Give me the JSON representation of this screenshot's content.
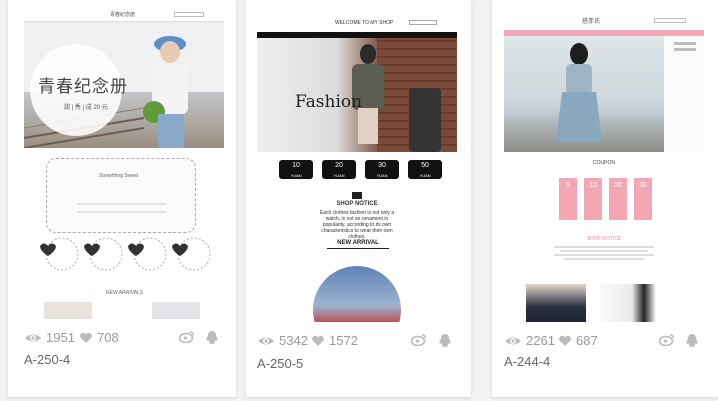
{
  "cards": [
    {
      "code": "A-250-4",
      "views": "1951",
      "likes": "708",
      "thumb": {
        "header_text": "青春纪念册",
        "hero_title": "青春纪念册",
        "hero_tags": "甜 | 秀 | 成 20 元",
        "frame_caption": "Something Sweet",
        "bottom_caption": "NEW ARRIVALS"
      }
    },
    {
      "code": "A-250-5",
      "views": "5342",
      "likes": "1572",
      "thumb": {
        "header_text": "WELCOME TO MY SHOP",
        "hero_word": "Fashion",
        "coupons": [
          "10",
          "20",
          "30",
          "50"
        ],
        "coupon_unit": "YUAN",
        "notice_title": "SHOP NOTICE",
        "notice_text": "Each clothes fashion is not only a watch, is not an ornament in popularity, according to its own characteristics to wear their own clothes.",
        "arrival": "NEW ARRIVAL"
      }
    },
    {
      "code": "A-244-4",
      "views": "2261",
      "likes": "687",
      "thumb": {
        "header_text": "搭赤氏",
        "coupon_title": "COUPON",
        "coupons": [
          "5",
          "10",
          "20",
          "30"
        ],
        "notice_title": "SHOP NOTICE"
      }
    }
  ],
  "icons": {
    "views": "eye-icon",
    "likes": "heart-icon",
    "weibo": "weibo-icon",
    "qq": "qq-icon"
  },
  "colors": {
    "page_bg": "#f2f2f2",
    "card_bg": "#ffffff",
    "stat_text": "#999999",
    "code_text": "#666666",
    "accent_pink": "#f4a7b5"
  }
}
